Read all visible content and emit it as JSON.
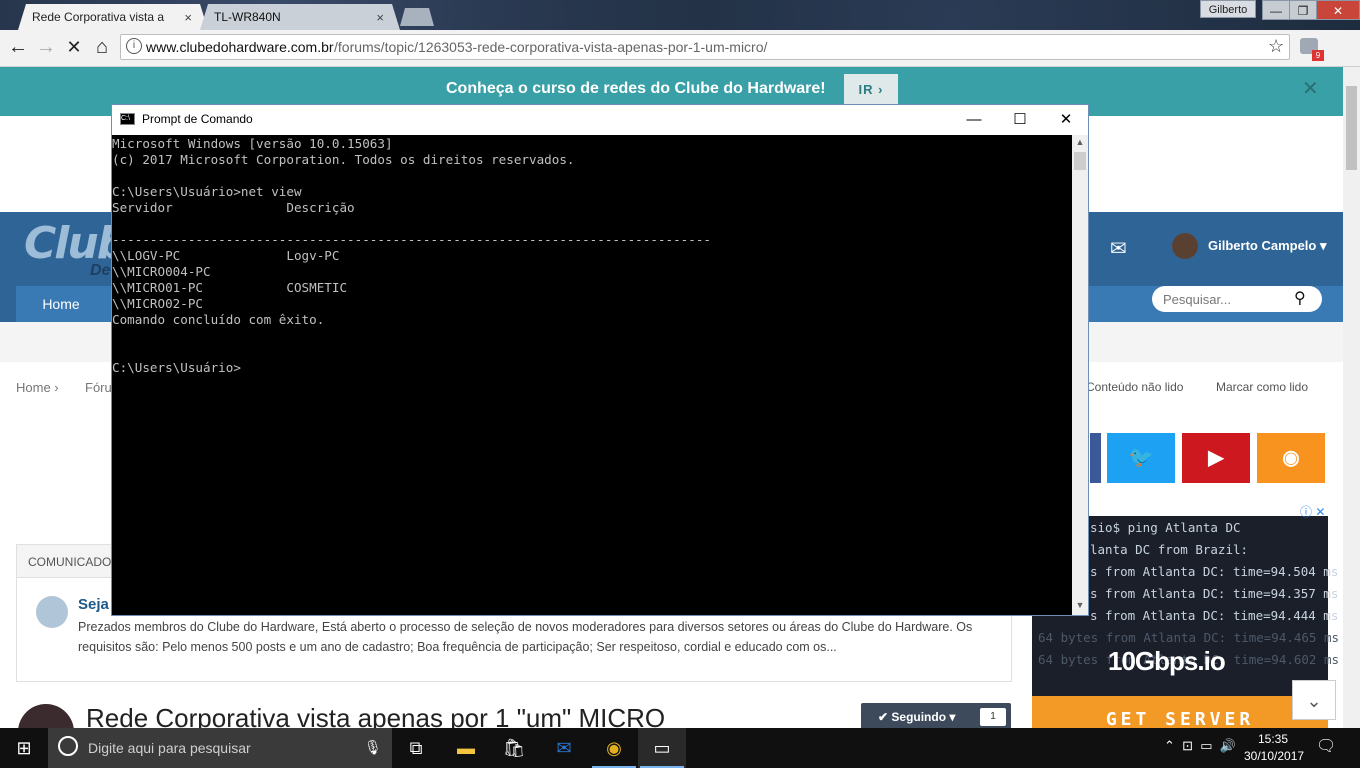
{
  "browser": {
    "tabs": [
      {
        "label": "Rede Corporativa vista a",
        "close": "×"
      },
      {
        "label": "TL-WR840N",
        "close": "×"
      }
    ],
    "profile_name": "Gilberto",
    "window_controls": [
      "—",
      "❐",
      "✕"
    ],
    "url_domain": "www.clubedohardware.com.br",
    "url_path": "/forums/topic/1263053-rede-corporativa-vista-apenas-por-1-um-micro/",
    "extension_badge": "9"
  },
  "site": {
    "banner_text": "Conheça o curso de redes do Clube do Hardware!",
    "banner_button": "IR ›",
    "logo_text": "Club",
    "logo_sub": "De",
    "nav_home": "Home",
    "user_name": "Gilberto Campelo ▾",
    "search_placeholder": "Pesquisar...",
    "breadcrumb_home": "Home ›",
    "breadcrumb_forum": "Fóru",
    "unread_link": "Conteúdo não lido",
    "mark_read_link": "Marcar como lido",
    "announce_label": "Comunicados",
    "announce_title": "Seja",
    "announce_text": "Prezados membros do Clube do Hardware, Está aberto o processo de seleção de novos moderadores para diversos setores ou áreas do Clube do Hardware. Os requisitos são:   Pelo menos 500 posts e um ano de cadastro; Boa frequência de participação; Ser respeitoso, cordial e educado com os...",
    "topic_title": "Rede Corporativa vista apenas por 1 \"um\" MICRO",
    "follow_label": "✔ Seguindo ▾",
    "follow_count": "1"
  },
  "ad": {
    "lines": [
      "sio$ ping Atlanta DC",
      "lanta DC from Brazil:",
      "s from Atlanta DC: time=94.504 ms",
      "s from Atlanta DC: time=94.357 ms",
      "s from Atlanta DC: time=94.444 ms",
      "64 bytes from Atlanta DC: time=94.465 ms",
      "64 bytes from Atlanta DC: time=94.602 ms"
    ],
    "brand": "10Gbps.io",
    "cta": "GET SERVER"
  },
  "cmd": {
    "title": "Prompt de Comando",
    "output": "Microsoft Windows [versão 10.0.15063]\n(c) 2017 Microsoft Corporation. Todos os direitos reservados.\n\nC:\\Users\\Usuário>net view\nServidor               Descrição\n\n-------------------------------------------------------------------------------\n\\\\LOGV-PC              Logv-PC\n\\\\MICRO004-PC\n\\\\MICRO01-PC           COSMETIC\n\\\\MICRO02-PC\nComando concluído com êxito.\n\n\nC:\\Users\\Usuário>"
  },
  "taskbar": {
    "search_placeholder": "Digite aqui para pesquisar",
    "time": "15:35",
    "date": "30/10/2017"
  }
}
